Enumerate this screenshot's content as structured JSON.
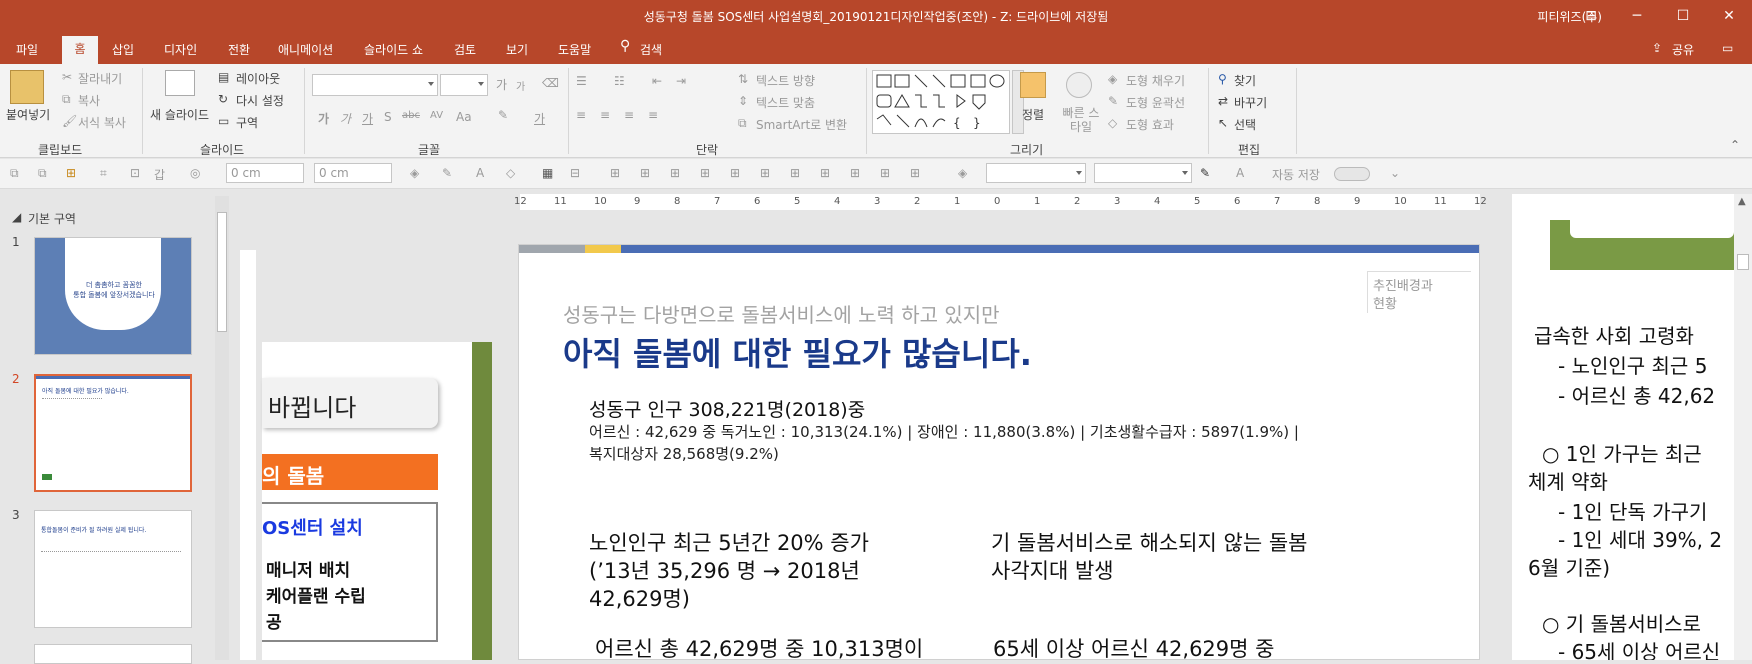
{
  "titlebar": {
    "title": "성동구청 돌봄 SOS센터 사업설명회_20190121디자인작업중(조안)  -  Z: 드라이브에 저장됨",
    "user": "피티위즈(주)",
    "btn_ribbon_icon": "⊟",
    "btn_min_icon": "─",
    "btn_max_icon": "☐",
    "btn_close_icon": "✕"
  },
  "tabs": {
    "file": "파일",
    "home": "홈",
    "insert": "삽입",
    "design": "디자인",
    "transitions": "전환",
    "animations": "애니메이션",
    "slideshow": "슬라이드 쇼",
    "review": "검토",
    "view": "보기",
    "help": "도움말",
    "search_icon": "⚲",
    "search": "검색",
    "share_icon": "⇪",
    "share": "공유",
    "comment_icon": "▭"
  },
  "ribbon": {
    "clipboard": {
      "paste": "붙여넣기",
      "cut": "잘라내기",
      "copy": "복사",
      "format_painter": "서식 복사",
      "label": "클립보드"
    },
    "slides": {
      "new_slide": "새 슬라이드",
      "layout": "레이아웃",
      "reset": "다시 설정",
      "section": "구역",
      "label": "슬라이드"
    },
    "font": {
      "label": "글꼴",
      "grow": "가",
      "shrink": "가",
      "bold": "가",
      "italic": "가",
      "underline": "가",
      "shadow": "S",
      "strike": "abc",
      "spacing": "AV",
      "case": "Aa",
      "color": "가"
    },
    "paragraph": {
      "text_direction": "텍스트 방향",
      "align_text": "텍스트 맞춤",
      "smartart": "SmartArt로 변환",
      "label": "단락"
    },
    "drawing": {
      "arrange": "정렬",
      "quick_styles": "빠른 스타일",
      "shape_fill": "도형 채우기",
      "shape_outline": "도형 윤곽선",
      "shape_effects": "도형 효과",
      "label": "그리기"
    },
    "editing": {
      "find": "찾기",
      "replace": "바꾸기",
      "select": "선택",
      "label": "편집"
    }
  },
  "qat": {
    "width1": "0 cm",
    "width2": "0 cm",
    "autosave": "자동 저장",
    "gaap": "갑"
  },
  "thumbnails": {
    "section_label": "기본 구역",
    "items": [
      {
        "num": "1",
        "line1": "더 촘촘하고 꼼꼼한",
        "line2": "통합 돌봄에 앞장서겠습니다"
      },
      {
        "num": "2",
        "title": "아직 돌봄에 대한 필요가 많습니다."
      },
      {
        "num": "3",
        "title": "통합돌봄이 준비가 될 하려원 실제 됩니다."
      }
    ]
  },
  "ruler": {
    "ticks": [
      "12",
      "11",
      "10",
      "9",
      "8",
      "7",
      "6",
      "5",
      "4",
      "3",
      "2",
      "1",
      "0",
      "1",
      "2",
      "3",
      "4",
      "5",
      "6",
      "7",
      "8",
      "9",
      "10",
      "11",
      "12"
    ]
  },
  "prev_slide": {
    "banner": "바뀝니다",
    "orange": "의 돌봄",
    "sos": "OS센터 설치",
    "line1": "매니저 배치",
    "line2": "케어플랜 수립",
    "line3": "공"
  },
  "slide": {
    "tag_line1": "추진배경과",
    "tag_line2": "현황",
    "subtitle": "성동구는 다방면으로 돌봄서비스에 노력 하고 있지만",
    "title": "아직 돌봄에 대한 필요가 많습니다.",
    "population": "성동구 인구 308,221명(2018)중",
    "stats_line1": "어르신 : 42,629 중 독거노인 : 10,313(24.1%) | 장애인 : 11,880(3.8%) | 기초생활수급자 : 5897(1.9%) |",
    "stats_line2": "복지대상자 28,568명(9.2%)",
    "left_head1": "노인인구 최근 5년간 20% 증가",
    "left_head2": "(’13년 35,296 명 → 2018년",
    "left_head3": "42,629명)",
    "right_head1": "기 돌봄서비스로 해소되지 않는 돌봄",
    "right_head2": "사각지대 발생",
    "left_bottom": "어르신 총 42,629명 중 10,313명이",
    "right_bottom": "65세 이상 어르신 42,629명 중"
  },
  "next_slide": {
    "l1": "급속한 사회 고령화",
    "l2": "- 노인인구 최근 5",
    "l3": "- 어르신 총 42,62",
    "l4": "○ 1인 가구는 최근",
    "l5": "체계 약화",
    "l6": "- 1인 단독 가구기",
    "l7": "- 1인 세대 39%, 2",
    "l8": "6월 기준)",
    "l9": "○ 기 돌봄서비스로",
    "l10": "- 65세 이상 어르신"
  },
  "colors": {
    "brand": "#b7472a",
    "slide_title": "#1a3a8a",
    "orange": "#f37021",
    "green": "#6f8a3d"
  }
}
